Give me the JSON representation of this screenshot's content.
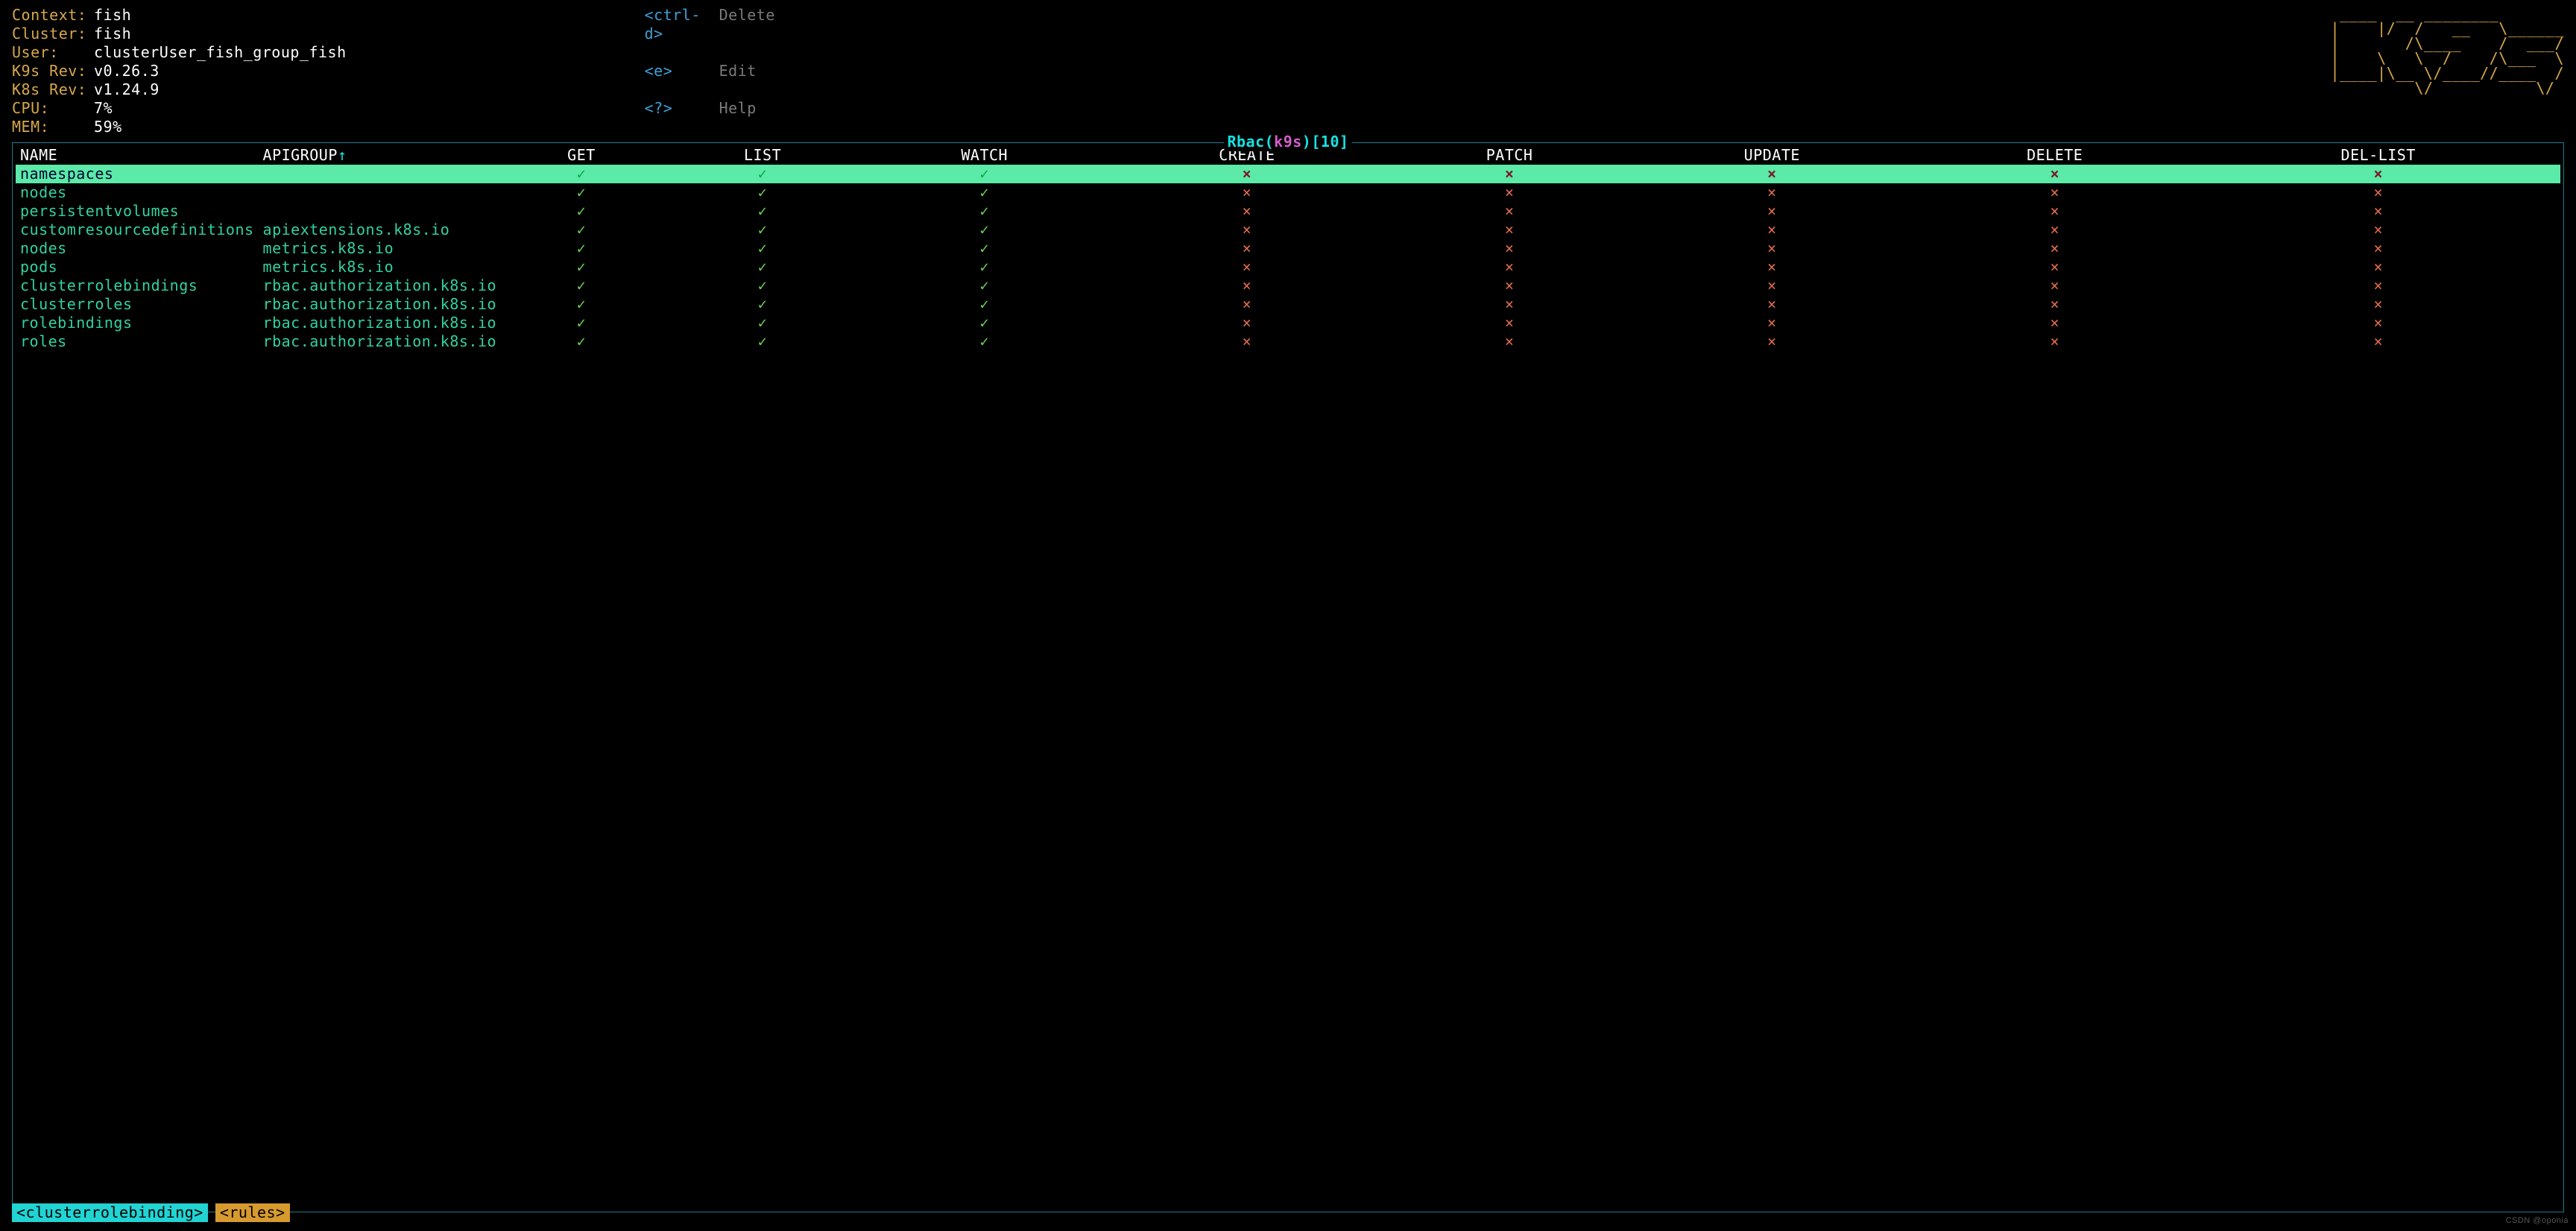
{
  "header": {
    "context_label": "Context:",
    "context_val": "fish",
    "cluster_label": "Cluster:",
    "cluster_val": "fish",
    "user_label": "User:",
    "user_val": "clusterUser_fish_group_fish",
    "k9srev_label": "K9s Rev:",
    "k9srev_val": "v0.26.3",
    "k8srev_label": "K8s Rev:",
    "k8srev_val": "v1.24.9",
    "cpu_label": "CPU:",
    "cpu_val": "7%",
    "mem_label": "MEM:",
    "mem_val": "59%"
  },
  "commands": [
    {
      "key": "<ctrl-d>",
      "desc": "Delete"
    },
    {
      "key": "<e>",
      "desc": "Edit"
    },
    {
      "key": "<?>",
      "desc": "Help"
    }
  ],
  "ascii": " ____  __ ________       \n|    |/  /   __   \\______\n|       /\\____    /  ___/\n|    \\   \\  /    /\\___  \\\n|____|\\__ \\/____//____  /\n         \\/           \\/ ",
  "panel": {
    "title_pre": " Rbac(",
    "title_mid": "k9s",
    "title_post1": ")[",
    "title_post2": "10",
    "title_post3": "] ",
    "sort_indicator": "↑",
    "columns": [
      "NAME",
      "APIGROUP",
      "GET",
      "LIST",
      "WATCH",
      "CREATE",
      "PATCH",
      "UPDATE",
      "DELETE",
      "DEL-LIST"
    ],
    "check": "✓",
    "cross": "×",
    "rows": [
      {
        "sel": true,
        "name": "namespaces",
        "apigroup": "",
        "get": true,
        "list": true,
        "watch": true,
        "create": false,
        "patch": false,
        "update": false,
        "delete": false,
        "dellist": false
      },
      {
        "sel": false,
        "name": "nodes",
        "apigroup": "",
        "get": true,
        "list": true,
        "watch": true,
        "create": false,
        "patch": false,
        "update": false,
        "delete": false,
        "dellist": false
      },
      {
        "sel": false,
        "name": "persistentvolumes",
        "apigroup": "",
        "get": true,
        "list": true,
        "watch": true,
        "create": false,
        "patch": false,
        "update": false,
        "delete": false,
        "dellist": false
      },
      {
        "sel": false,
        "name": "customresourcedefinitions",
        "apigroup": "apiextensions.k8s.io",
        "get": true,
        "list": true,
        "watch": true,
        "create": false,
        "patch": false,
        "update": false,
        "delete": false,
        "dellist": false
      },
      {
        "sel": false,
        "name": "nodes",
        "apigroup": "metrics.k8s.io",
        "get": true,
        "list": true,
        "watch": true,
        "create": false,
        "patch": false,
        "update": false,
        "delete": false,
        "dellist": false
      },
      {
        "sel": false,
        "name": "pods",
        "apigroup": "metrics.k8s.io",
        "get": true,
        "list": true,
        "watch": true,
        "create": false,
        "patch": false,
        "update": false,
        "delete": false,
        "dellist": false
      },
      {
        "sel": false,
        "name": "clusterrolebindings",
        "apigroup": "rbac.authorization.k8s.io",
        "get": true,
        "list": true,
        "watch": true,
        "create": false,
        "patch": false,
        "update": false,
        "delete": false,
        "dellist": false
      },
      {
        "sel": false,
        "name": "clusterroles",
        "apigroup": "rbac.authorization.k8s.io",
        "get": true,
        "list": true,
        "watch": true,
        "create": false,
        "patch": false,
        "update": false,
        "delete": false,
        "dellist": false
      },
      {
        "sel": false,
        "name": "rolebindings",
        "apigroup": "rbac.authorization.k8s.io",
        "get": true,
        "list": true,
        "watch": true,
        "create": false,
        "patch": false,
        "update": false,
        "delete": false,
        "dellist": false
      },
      {
        "sel": false,
        "name": "roles",
        "apigroup": "rbac.authorization.k8s.io",
        "get": true,
        "list": true,
        "watch": true,
        "create": false,
        "patch": false,
        "update": false,
        "delete": false,
        "dellist": false
      }
    ]
  },
  "crumbs": [
    {
      "label": "<clusterrolebinding>",
      "cls": "c1"
    },
    {
      "label": "<rules>",
      "cls": "c2"
    }
  ],
  "watermark": "CSDN @oponia"
}
